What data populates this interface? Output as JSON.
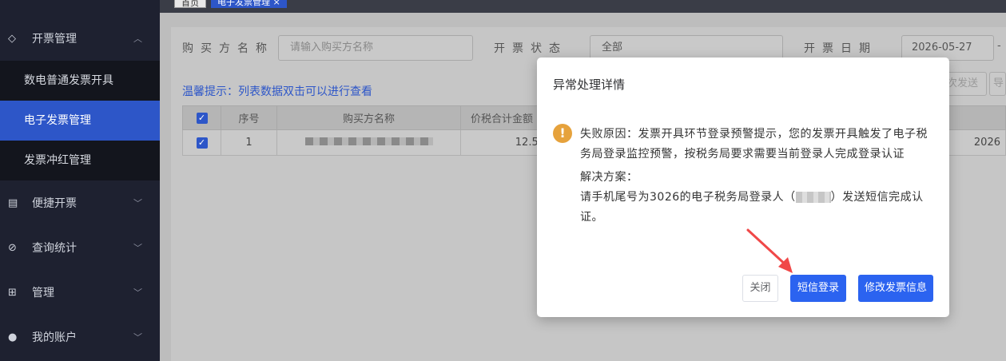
{
  "sidebar": {
    "groups": [
      {
        "label": "开票管理",
        "icon": "tag-icon",
        "expanded": true
      },
      {
        "label": "便捷开票",
        "icon": "document-icon"
      },
      {
        "label": "查询统计",
        "icon": "search-icon"
      },
      {
        "label": "管理",
        "icon": "grid-icon"
      },
      {
        "label": "我的账户",
        "icon": "user-icon"
      }
    ],
    "subitems": [
      "数电普通发票开具",
      "电子发票管理",
      "发票冲红管理"
    ],
    "active_subitem": "电子发票管理"
  },
  "breadcrumb": {
    "home": "首页",
    "current": "电子发票管理 ×"
  },
  "filters": {
    "buyer_label": "购买方名称",
    "buyer_placeholder": "请输入购买方名称",
    "status_label": "开票状态",
    "status_value": "全部",
    "date_label": "开票日期",
    "date_value": "2026-05-27",
    "date_sep": "-"
  },
  "tip": "温馨提示：列表数据双击可以进行查看",
  "actions": {
    "resend": "次发送",
    "export": "导"
  },
  "table": {
    "headers": [
      "序号",
      "购买方名称",
      "价税合计金额"
    ],
    "rows": [
      {
        "index": "1",
        "amount": "12.50",
        "date": "2026"
      }
    ]
  },
  "modal": {
    "title": "异常处理详情",
    "reason": "失败原因：发票开具环节登录预警提示，您的发票开具触发了电子税务局登录监控预警，按税务局要求需要当前登录人完成登录认证",
    "solution_label": "解决方案：",
    "solution_prefix": "请手机尾号为3026的电子税务局登录人（",
    "solution_suffix": "）发送短信完成认证。",
    "buttons": {
      "close": "关闭",
      "sms_login": "短信登录",
      "edit_invoice": "修改发票信息"
    }
  },
  "colors": {
    "primary": "#2b63f0",
    "warning": "#e6a23c",
    "sidebar_bg": "#1e2130",
    "active": "#2d56c8"
  }
}
